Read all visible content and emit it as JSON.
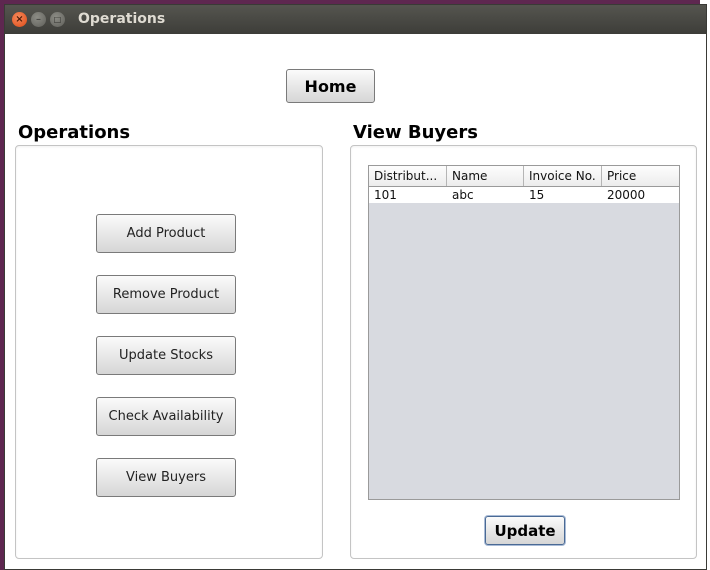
{
  "window": {
    "title": "Operations"
  },
  "home_button": "Home",
  "operations": {
    "title": "Operations",
    "buttons": [
      "Add Product",
      "Remove Product",
      "Update Stocks",
      "Check Availability",
      "View Buyers"
    ]
  },
  "view_buyers": {
    "title": "View Buyers",
    "columns": [
      "Distribut...",
      "Name",
      "Invoice No.",
      "Price"
    ],
    "rows": [
      [
        "101",
        "abc",
        "15",
        "20000"
      ]
    ],
    "update_button": "Update"
  }
}
